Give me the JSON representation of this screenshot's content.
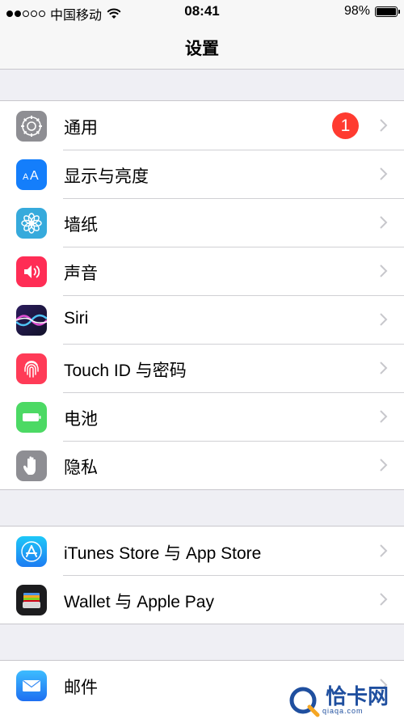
{
  "status_bar": {
    "carrier": "中国移动",
    "time": "08:41",
    "battery_percent": "98%",
    "battery_level": 0.98,
    "signal_bars_filled": 2,
    "signal_bars_total": 5
  },
  "nav": {
    "title": "设置"
  },
  "groups": [
    {
      "items": [
        {
          "label": "通用",
          "icon": "gear-icon",
          "color": "#8e8e93",
          "badge": "1"
        },
        {
          "label": "显示与亮度",
          "icon": "text-size-icon",
          "color": "#147efb"
        },
        {
          "label": "墙纸",
          "icon": "flower-icon",
          "color": "#36aadc"
        },
        {
          "label": "声音",
          "icon": "speaker-icon",
          "color": "#ff2d55"
        },
        {
          "label": "Siri",
          "icon": "siri-icon",
          "color": "#1a1a3a"
        },
        {
          "label": "Touch ID 与密码",
          "icon": "fingerprint-icon",
          "color": "#ff3b57"
        },
        {
          "label": "电池",
          "icon": "battery-icon",
          "color": "#4cd964"
        },
        {
          "label": "隐私",
          "icon": "hand-icon",
          "color": "#8e8e93"
        }
      ]
    },
    {
      "items": [
        {
          "label": "iTunes Store 与 App Store",
          "icon": "app-store-icon",
          "color": "#1d9bf0"
        },
        {
          "label": "Wallet 与 Apple Pay",
          "icon": "wallet-icon",
          "color": "#1c1c1e"
        }
      ]
    },
    {
      "items": [
        {
          "label": "邮件",
          "icon": "mail-icon",
          "color": "#2f8ff7"
        }
      ]
    }
  ],
  "watermark": {
    "name": "恰卡网",
    "url": "qiaqa.com"
  }
}
